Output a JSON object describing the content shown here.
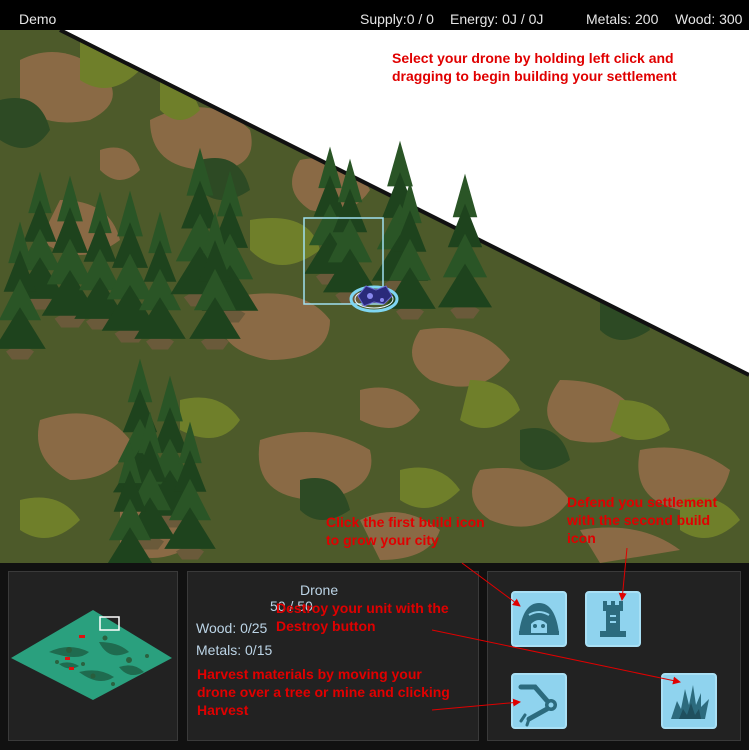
{
  "topbar": {
    "title": "Demo",
    "supply": "Supply:0 / 0",
    "energy": "Energy: 0J / 0J",
    "metals": "Metals: 200",
    "wood": "Wood: 300"
  },
  "tips": {
    "select": [
      "Select your drone by holding left click and",
      "dragging to begin building your settlement"
    ],
    "build": [
      "Click the first build icon",
      "to grow your city"
    ],
    "defend": [
      "Defend you settlement",
      "with the second build",
      "icon"
    ],
    "destroy": [
      "Destroy your unit with the",
      "Destroy button"
    ],
    "harvest": [
      "Harvest materials by moving your",
      "drone over a tree or mine and clicking",
      "Harvest"
    ]
  },
  "unit": {
    "name": "Drone",
    "health": "50 / 50",
    "wood": "Wood: 0/25",
    "metals": "Metals: 0/15"
  },
  "commands": [
    {
      "name": "build-city-hall",
      "icon": "dome-house-icon"
    },
    {
      "name": "build-tower",
      "icon": "rook-tower-icon"
    },
    {
      "name": "harvest",
      "icon": "robot-arm-icon"
    },
    {
      "name": "destroy",
      "icon": "explosion-icon"
    }
  ],
  "colors": {
    "topbar_bg": "#000000",
    "hud_bg": "#111111",
    "button_bg": "#8fd3ee",
    "tip_text": "#e00000",
    "selection_box": "#9fe0f0"
  }
}
